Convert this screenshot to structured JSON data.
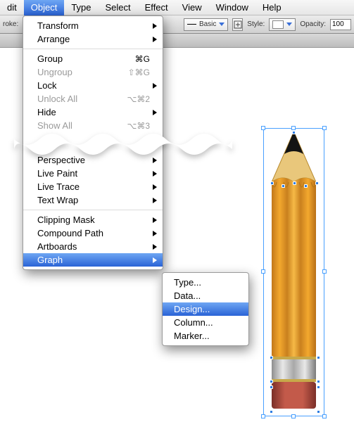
{
  "menubar": {
    "items": [
      "dit",
      "Object",
      "Type",
      "Select",
      "Effect",
      "View",
      "Window",
      "Help"
    ],
    "active_index": 1
  },
  "options_bar": {
    "stroke_label": "roke:",
    "brush_basic": "Basic",
    "style_label": "Style:",
    "opacity_label": "Opacity:",
    "opacity_value": "100"
  },
  "object_menu": {
    "group1": [
      {
        "label": "Transform",
        "submenu": true
      },
      {
        "label": "Arrange",
        "submenu": true
      }
    ],
    "group2": [
      {
        "label": "Group",
        "shortcut": "⌘G"
      },
      {
        "label": "Ungroup",
        "shortcut": "⇧⌘G",
        "disabled": true
      },
      {
        "label": "Lock",
        "submenu": true
      },
      {
        "label": "Unlock All",
        "shortcut": "⌥⌘2",
        "disabled": true
      },
      {
        "label": "Hide",
        "submenu": true
      },
      {
        "label": "Show All",
        "shortcut": "⌥⌘3",
        "disabled": true
      }
    ],
    "group3": [
      {
        "label": "Perspective",
        "submenu": true
      },
      {
        "label": "Live Paint",
        "submenu": true
      },
      {
        "label": "Live Trace",
        "submenu": true
      },
      {
        "label": "Text Wrap",
        "submenu": true
      }
    ],
    "group4": [
      {
        "label": "Clipping Mask",
        "submenu": true
      },
      {
        "label": "Compound Path",
        "submenu": true
      },
      {
        "label": "Artboards",
        "submenu": true
      },
      {
        "label": "Graph",
        "submenu": true,
        "highlighted": true
      }
    ]
  },
  "graph_submenu": {
    "items": [
      "Type...",
      "Data...",
      "Design...",
      "Column...",
      "Marker..."
    ],
    "highlighted_index": 2
  },
  "artwork": {
    "description": "pencil-illustration-selected"
  }
}
